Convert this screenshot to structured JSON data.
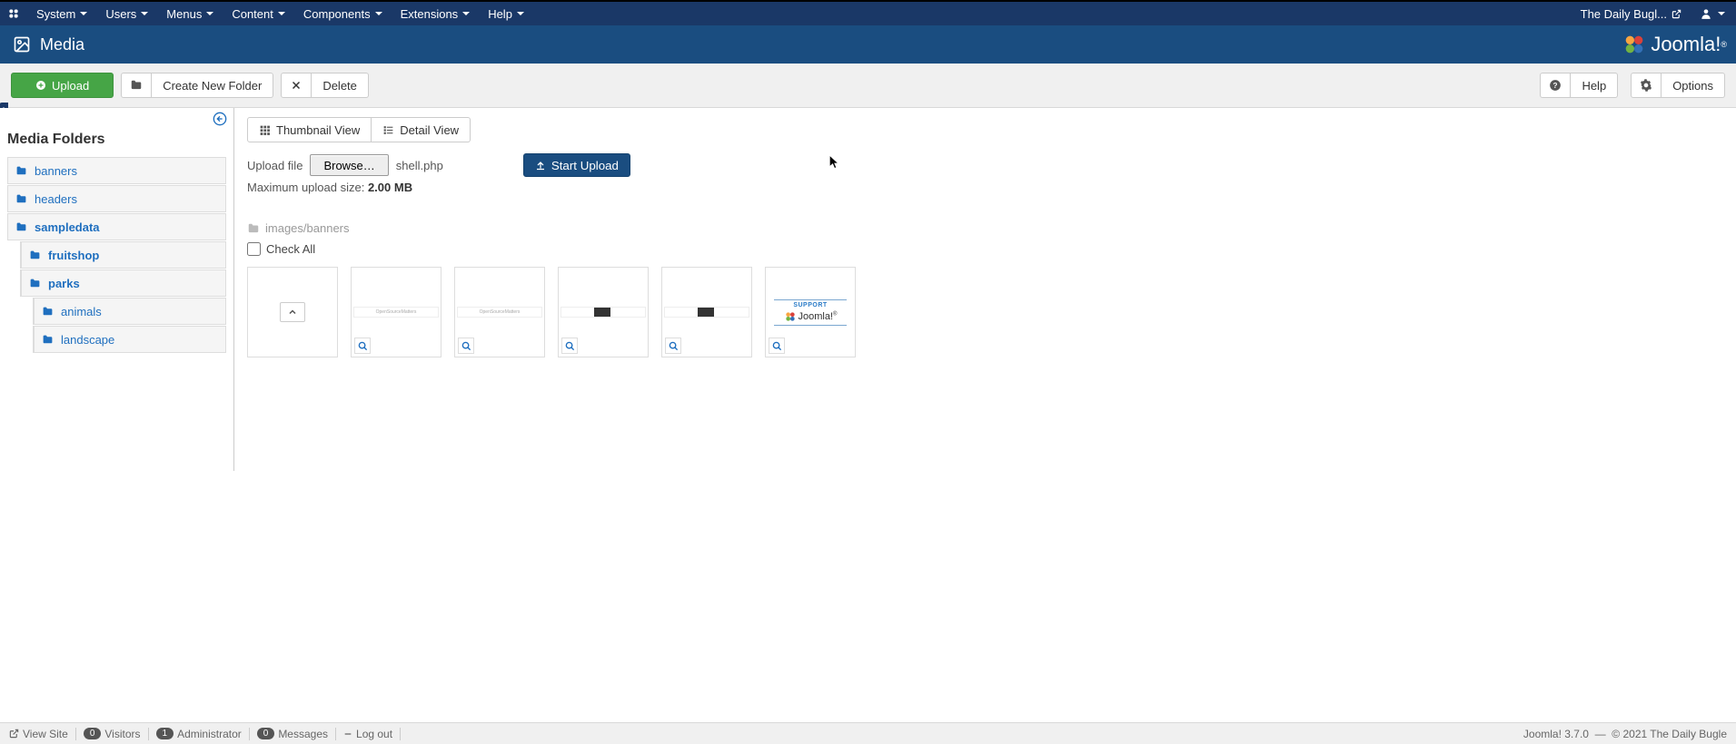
{
  "adminMenu": {
    "items": [
      "System",
      "Users",
      "Menus",
      "Content",
      "Components",
      "Extensions",
      "Help"
    ],
    "siteName": "The Daily Bugl..."
  },
  "header": {
    "pageTitle": "Media"
  },
  "toolbar": {
    "upload": "Upload",
    "createFolder": "Create New Folder",
    "delete": "Delete",
    "help": "Help",
    "options": "Options"
  },
  "sidebar": {
    "title": "Media Folders",
    "folders": {
      "banners": "banners",
      "headers": "headers",
      "sampledata": "sampledata",
      "fruitshop": "fruitshop",
      "parks": "parks",
      "animals": "animals",
      "landscape": "landscape"
    }
  },
  "content": {
    "thumbView": "Thumbnail View",
    "detailView": "Detail View",
    "uploadFileLabel": "Upload file",
    "browseLabel": "Browse…",
    "selectedFile": "shell.php",
    "startUpload": "Start Upload",
    "maxSizeLabel": "Maximum upload size: ",
    "maxSize": "2.00 MB",
    "breadcrumb": "images/banners",
    "checkAll": "Check All",
    "thumbs": {
      "osm": "OpenSourceMatters",
      "support": "SUPPORT"
    }
  },
  "footer": {
    "viewSite": "View Site",
    "visitors": "Visitors",
    "visitorsCount": "0",
    "admin": "Administrator",
    "adminCount": "1",
    "messages": "Messages",
    "messagesCount": "0",
    "logout": "Log out",
    "version": "Joomla! 3.7.0",
    "sep": "—",
    "copyright": "© 2021 The Daily Bugle"
  }
}
